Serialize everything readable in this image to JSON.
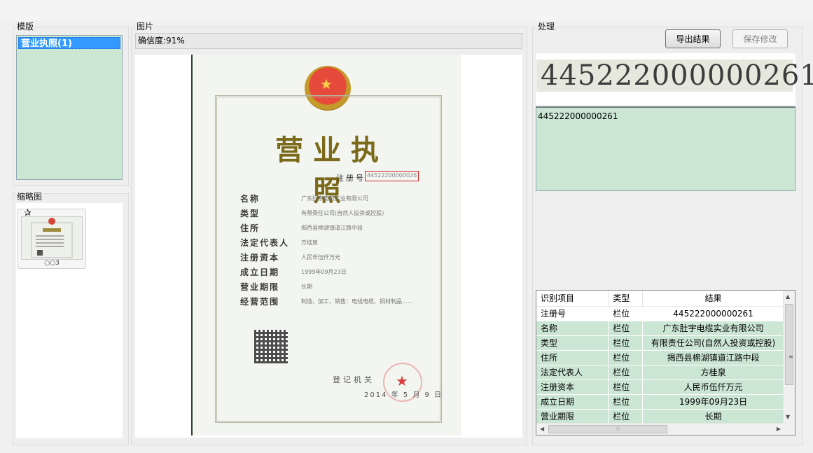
{
  "panels": {
    "template_title": "模版",
    "thumbnail_title": "缩略图",
    "image_title": "图片",
    "process_title": "处理"
  },
  "template": {
    "items": [
      {
        "label": "营业执照(1)",
        "selected": true
      }
    ]
  },
  "thumbnail": {
    "caption": "○○3",
    "starred": true
  },
  "image": {
    "confidence_text": "确信度:91%",
    "license": {
      "title": "营业执照",
      "reg_label": "注册号",
      "reg_value": "445222000000261",
      "fields": [
        {
          "key": "名称",
          "value": "广东肚宇电缆实业有限公司"
        },
        {
          "key": "类型",
          "value": "有限责任公司(自然人投资或控股)"
        },
        {
          "key": "住所",
          "value": "揭西县棉湖镇道江路中段"
        },
        {
          "key": "法定代表人",
          "value": "方桂泉"
        },
        {
          "key": "注册资本",
          "value": "人民币伍仟万元"
        },
        {
          "key": "成立日期",
          "value": "1999年09月23日"
        },
        {
          "key": "营业期限",
          "value": "长期"
        },
        {
          "key": "经营范围",
          "value": "制造、加工、销售：电线电缆、铜材制品……"
        }
      ],
      "registrar": "登记机关",
      "issue_date": "2014 年 5 月 9 日"
    }
  },
  "process": {
    "export_label": "导出结果",
    "save_label": "保存修改",
    "crop_text": "445222000000261",
    "result_text": "445222000000261",
    "table": {
      "headers": [
        "识别项目",
        "类型",
        "结果"
      ],
      "rows": [
        [
          "注册号",
          "栏位",
          "445222000000261"
        ],
        [
          "名称",
          "栏位",
          "广东肚宇电缆实业有限公司"
        ],
        [
          "类型",
          "栏位",
          "有限责任公司(自然人投资或控股)"
        ],
        [
          "住所",
          "栏位",
          "揭西县棉湖镇道江路中段"
        ],
        [
          "法定代表人",
          "栏位",
          "方桂泉"
        ],
        [
          "注册资本",
          "栏位",
          "人民币伍仟万元"
        ],
        [
          "成立日期",
          "栏位",
          "1999年09月23日"
        ],
        [
          "营业期限",
          "栏位",
          "长期"
        ]
      ]
    }
  },
  "colors": {
    "list_bg": "#cce6d4",
    "selection": "#3399ff",
    "highlight_box": "#d42020"
  }
}
